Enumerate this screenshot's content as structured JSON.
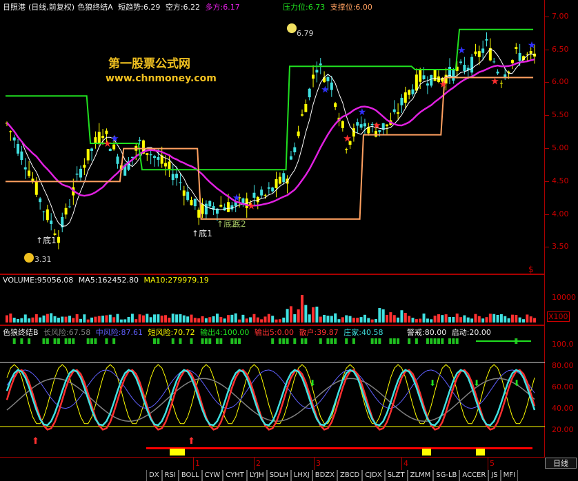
{
  "main_header": {
    "stock": "日照港",
    "period": "(日线,前复权)",
    "indicator": "色狼终结A",
    "short_trend": "短趋势:6.29",
    "short_side": "空方:6.22",
    "long_side": "多方:6.17",
    "resistance": "压力位:6.73",
    "support": "支撑位:6.00"
  },
  "brand": {
    "name": "第一股票公式网",
    "url": "www.chnmoney.com"
  },
  "price_annotations": {
    "high": "6.79",
    "low": "3.31",
    "bottom1": "底1",
    "bottom1b": "底1",
    "bottom_a": "底2",
    "bottom_b": "底2"
  },
  "price_axis": [
    "7.00",
    "6.50",
    "6.00",
    "5.50",
    "5.00",
    "4.50",
    "4.00",
    "3.50"
  ],
  "dollar_mark": "$",
  "volume_header": {
    "label": "VOLUME:95056.08",
    "ma5": "MA5:162452.80",
    "ma10": "MA10:279979.19"
  },
  "volume_axis": {
    "top": "10000",
    "unit": "X100"
  },
  "osc_header": {
    "name": "色狼终结B",
    "long_risk": "长风险:67.58",
    "mid_risk": "中风险:87.61",
    "short_risk": "短风险:70.72",
    "out4": "输出4:100.00",
    "out5": "输出5:0.00",
    "retail": "散户:39.87",
    "dealer": "庄家:40.58",
    "alert": "警戒:80.00",
    "start": "启动:20.00"
  },
  "osc_axis": [
    "100.0",
    "80.00",
    "60.00",
    "40.00",
    "20.00"
  ],
  "months": [
    "1",
    "2",
    "3",
    "4",
    "5"
  ],
  "day_button": "日线",
  "tabs": [
    "DX",
    "RSI",
    "BOLL",
    "CYW",
    "CYHT",
    "LYJH",
    "SDLH",
    "LHXJ",
    "BDZX",
    "ZBCD",
    "CJDX",
    "SLZT",
    "ZLMM",
    "SG-LB",
    "ACCER",
    "JS",
    "MFI"
  ],
  "colors": {
    "up": "#ff3030",
    "down": "#40e0e0",
    "green": "#20e020",
    "orange": "#ffa060",
    "magenta": "#e020e0",
    "yellow": "#ffff00",
    "frame": "#aa0000"
  }
}
